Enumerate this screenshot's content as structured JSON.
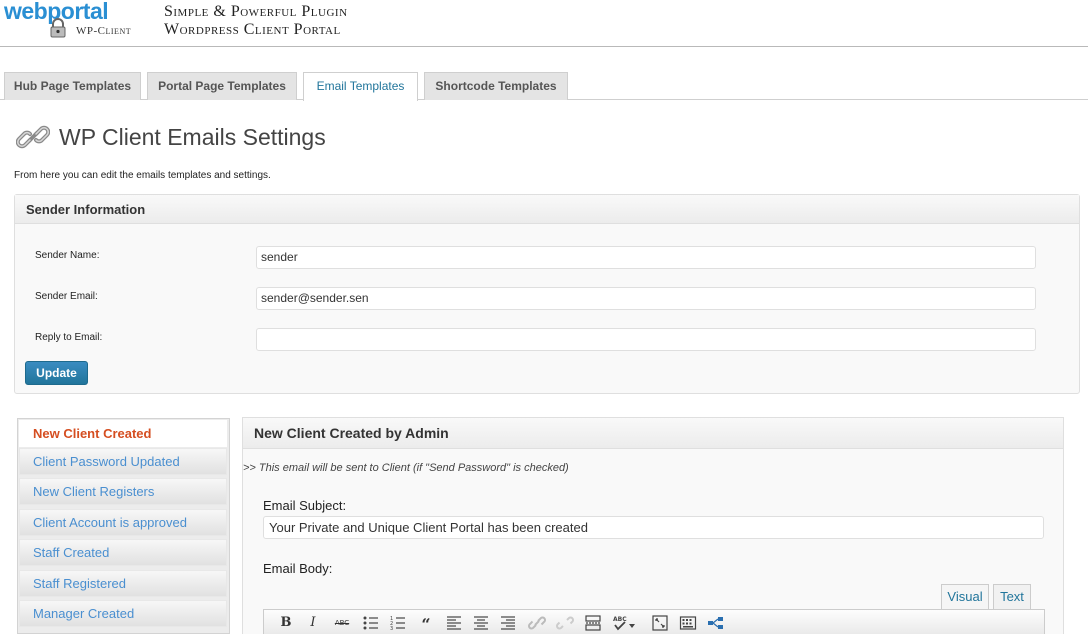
{
  "header": {
    "logo_text": "webportal",
    "logo_sub": "WP-Client",
    "tagline_line1": "Simple & Powerful Plugin",
    "tagline_line2": "Wordpress Client Portal"
  },
  "tabs": [
    {
      "label": "Hub Page Templates",
      "active": false
    },
    {
      "label": "Portal Page Templates",
      "active": false
    },
    {
      "label": "Email Templates",
      "active": true
    },
    {
      "label": "Shortcode Templates",
      "active": false
    }
  ],
  "page": {
    "title": "WP Client Emails Settings",
    "description": "From here you can edit the emails templates and settings."
  },
  "sender": {
    "heading": "Sender Information",
    "name_label": "Sender Name:",
    "name_value": "sender",
    "email_label": "Sender Email:",
    "email_value": "sender@sender.sen",
    "reply_label": "Reply to Email:",
    "reply_value": "",
    "update_label": "Update"
  },
  "email_list": [
    {
      "label": "New Client Created",
      "active": true
    },
    {
      "label": "Client Password Updated",
      "active": false
    },
    {
      "label": "New Client Registers",
      "active": false
    },
    {
      "label": "Client Account is approved",
      "active": false
    },
    {
      "label": "Staff Created",
      "active": false
    },
    {
      "label": "Staff Registered",
      "active": false
    },
    {
      "label": "Manager Created",
      "active": false
    }
  ],
  "email_panel": {
    "heading": "New Client Created by Admin",
    "note": ">> This email will be sent to Client (if \"Send Password\" is checked)",
    "subject_label": "Email Subject:",
    "subject_value": "Your Private and Unique Client Portal has been created",
    "body_label": "Email Body:",
    "editor_tabs": {
      "visual": "Visual",
      "text": "Text"
    },
    "toolbar": [
      "bold-icon",
      "italic-icon",
      "strikethrough-icon",
      "bullet-list-icon",
      "numbered-list-icon",
      "blockquote-icon",
      "align-left-icon",
      "align-center-icon",
      "align-right-icon",
      "link-icon",
      "unlink-icon",
      "read-more-icon",
      "spellcheck-icon",
      "fullscreen-icon",
      "kitchen-sink-icon",
      "placeholder-icon"
    ]
  },
  "colors": {
    "accent": "#21759b",
    "link": "#4a8fd0",
    "active_item": "#d54e21",
    "logo": "#2a8fd3"
  }
}
